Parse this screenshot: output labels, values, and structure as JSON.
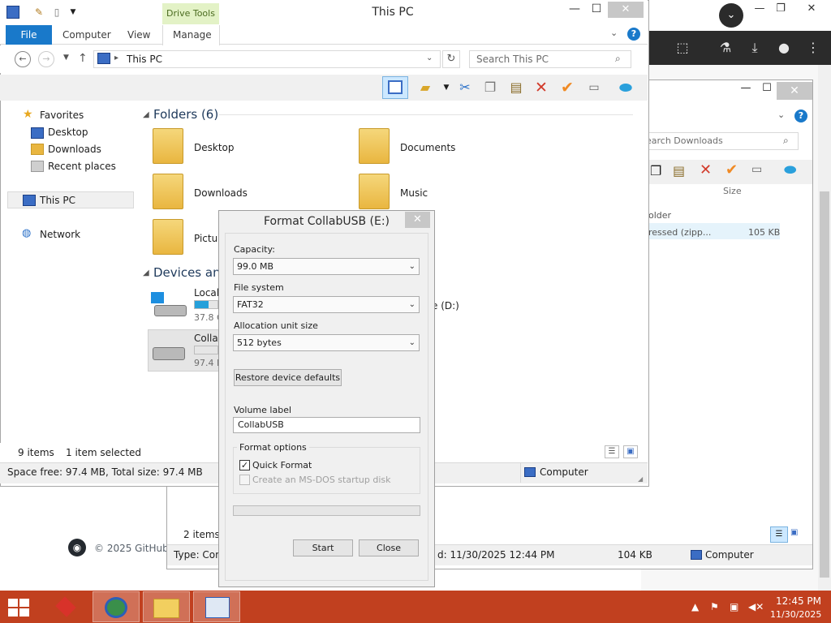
{
  "explorer_this_pc": {
    "title": "This PC",
    "context_tab": "Drive Tools",
    "ribbon_tabs": [
      "File",
      "Computer",
      "View",
      "Manage"
    ],
    "address": "This PC",
    "search_placeholder": "Search This PC",
    "nav": {
      "favorites": "Favorites",
      "desktop": "Desktop",
      "downloads": "Downloads",
      "recent": "Recent places",
      "this_pc": "This PC",
      "network": "Network"
    },
    "folders_header": "Folders (6)",
    "folders": [
      "Desktop",
      "Documents",
      "Downloads",
      "Music",
      "Pictur"
    ],
    "devices_header": "Devices and",
    "drives": [
      {
        "label": "Local",
        "sub": "37.8 G",
        "fill": 0.62
      },
      {
        "label": "Collab",
        "sub": "97.4 M",
        "fill": 0.0
      }
    ],
    "drive_d_label": "e (D:)",
    "status_count": "9 items",
    "status_selected": "1 item selected",
    "space_info": "Space free: 97.4 MB, Total size: 97.4 MB",
    "computer_label": "Computer"
  },
  "format_dialog": {
    "title": "Format CollabUSB (E:)",
    "capacity_label": "Capacity:",
    "capacity_value": "99.0 MB",
    "fs_label": "File system",
    "fs_value": "FAT32",
    "alloc_label": "Allocation unit size",
    "alloc_value": "512 bytes",
    "restore_btn": "Restore device defaults",
    "volume_label": "Volume label",
    "volume_value": "CollabUSB",
    "options_title": "Format options",
    "quick_format": "Quick Format",
    "quick_format_checked": true,
    "msdos": "Create an MS-DOS startup disk",
    "start_btn": "Start",
    "close_btn": "Close"
  },
  "explorer_downloads": {
    "search_placeholder": "earch Downloads",
    "size_header": "Size",
    "row_folder": "older",
    "row_zip": "ressed (zipp...",
    "row_zip_size": "105 KB",
    "status_count": "2 items",
    "type_text": "Type: Com",
    "modified_text": "d: 11/30/2025 12:44 PM",
    "size_text": "104 KB",
    "computer_label": "Computer"
  },
  "browser": {
    "footer": "© 2025 GitHub, I"
  },
  "taskbar": {
    "time": "12:45 PM",
    "date": "11/30/2025"
  },
  "colors": {
    "accent": "#1979ca",
    "taskbar": "#c1401f",
    "drive_fill": "#26a0da",
    "drive_tools": "#e3f2c6"
  }
}
